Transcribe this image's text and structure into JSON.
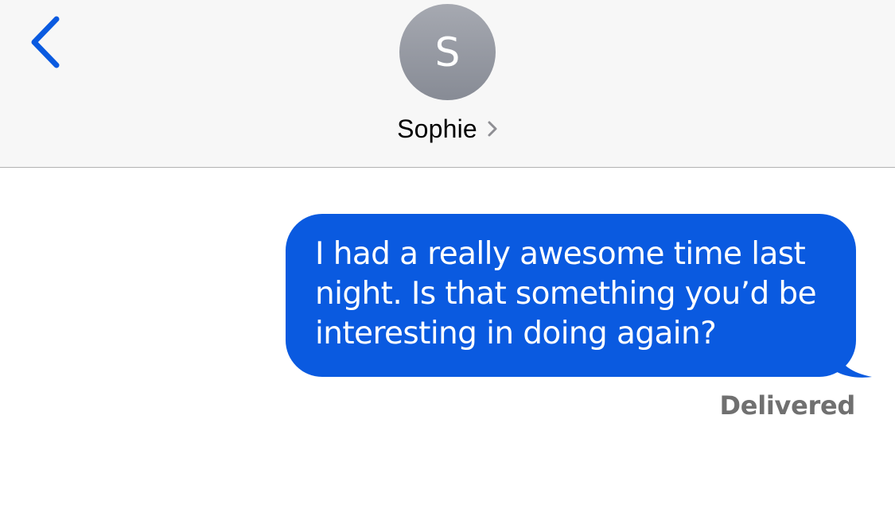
{
  "header": {
    "back_icon": "chevron-left-icon",
    "avatar_initial": "S",
    "contact_name": "Sophie",
    "disclosure_icon": "chevron-right-icon"
  },
  "conversation": {
    "messages": [
      {
        "direction": "outgoing",
        "text": "I had a really awesome time last\nnight. Is that something you’d be\ninteresting in doing again?",
        "status": "Delivered"
      }
    ]
  },
  "colors": {
    "accent": "#0a5ae0",
    "header_background": "#f7f7f7",
    "avatar": "#9a9da5",
    "status_text": "#707070"
  }
}
